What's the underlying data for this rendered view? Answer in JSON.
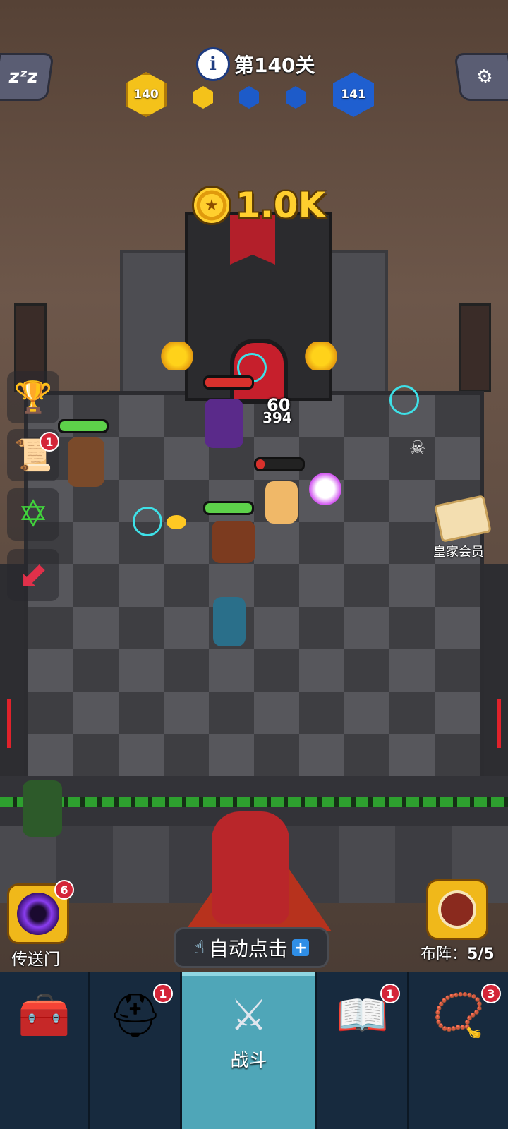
{
  "hud": {
    "level_label": "第140关",
    "current_level": "140",
    "next_level": "141",
    "info_icon": "info-icon",
    "sleep_icon": "zzz-icon",
    "settings_icon": "gear-icon"
  },
  "reward": {
    "coin_value": "1.0K",
    "icon": "coin-icon"
  },
  "battle": {
    "damage_top": "60",
    "damage_bottom": "394"
  },
  "left_buttons": [
    {
      "name": "ranking",
      "icon": "trophy-icon",
      "badge": ""
    },
    {
      "name": "quests",
      "icon": "scroll-icon",
      "badge": "1"
    },
    {
      "name": "hexagram",
      "icon": "star-of-david-icon",
      "badge": ""
    },
    {
      "name": "boost",
      "icon": "red-arrow-icon",
      "badge": ""
    }
  ],
  "royal": {
    "label": "皇家会员"
  },
  "portal": {
    "label": "传送门",
    "badge": "6"
  },
  "formation": {
    "label": "布阵：",
    "count": "5/5"
  },
  "auto_tap": {
    "label": "自动点击",
    "plus": "+"
  },
  "nav": [
    {
      "name": "treasure",
      "icon": "treasure-chest-icon",
      "label": "",
      "badge": ""
    },
    {
      "name": "heroes",
      "icon": "viking-helmet-icon",
      "label": "",
      "badge": "1"
    },
    {
      "name": "battle",
      "icon": "crossed-swords-icon",
      "label": "战斗",
      "badge": ""
    },
    {
      "name": "spellbook",
      "icon": "spellbook-icon",
      "label": "",
      "badge": "1"
    },
    {
      "name": "amulet",
      "icon": "amulet-icon",
      "label": "",
      "badge": "3"
    }
  ],
  "colors": {
    "accent_yellow": "#f4c21a",
    "accent_blue": "#1f5fd0",
    "nav_active": "#4fa6b8",
    "badge_red": "#d42538"
  }
}
